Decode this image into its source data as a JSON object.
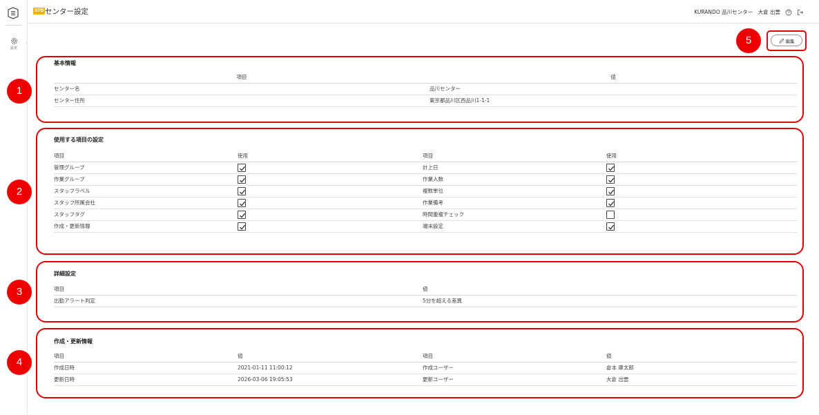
{
  "app": {
    "page_badge": "STD",
    "page_title": "センター設定",
    "user_info": "KURANDO 品川センター　大倉 出雲",
    "rail_settings_label": "設定"
  },
  "actions": {
    "edit_label": "編集"
  },
  "basic_info": {
    "title": "基本情報",
    "headers": [
      "項目",
      "値"
    ],
    "rows": [
      [
        "センター名",
        "品川センター"
      ],
      [
        "センター住所",
        "東京都品川区西品川1-1-1"
      ]
    ]
  },
  "usage_settings": {
    "title": "使用する項目の設定",
    "headers": [
      "項目",
      "使用",
      "項目",
      "使用"
    ],
    "rows": [
      {
        "left": "管理グループ",
        "left_checked": true,
        "right": "計上日",
        "right_checked": true
      },
      {
        "left": "作業グループ",
        "left_checked": true,
        "right": "作業人数",
        "right_checked": true
      },
      {
        "left": "スタッフラベル",
        "left_checked": true,
        "right": "複数単位",
        "right_checked": true
      },
      {
        "left": "スタッフ所属会社",
        "left_checked": true,
        "right": "作業備考",
        "right_checked": true
      },
      {
        "left": "スタッフタグ",
        "left_checked": true,
        "right": "時間重複チェック",
        "right_checked": false
      },
      {
        "left": "作成・更新情報",
        "left_checked": true,
        "right": "端末設定",
        "right_checked": true
      }
    ]
  },
  "detail_settings": {
    "title": "詳細設定",
    "headers": [
      "項目",
      "値"
    ],
    "rows": [
      [
        "出勤アラート判定",
        "5分を超える差異"
      ]
    ]
  },
  "audit_info": {
    "title": "作成・更新情報",
    "headers": [
      "項目",
      "値",
      "項目",
      "値"
    ],
    "rows": [
      [
        "作成日時",
        "2021-01-11 11:00:12",
        "作成ユーザー",
        "倉本 庫太郎"
      ],
      [
        "更新日時",
        "2026-03-06 19:05:53",
        "更新ユーザー",
        "大倉 出雲"
      ]
    ]
  },
  "markers": [
    "1",
    "2",
    "3",
    "4",
    "5"
  ],
  "colors": {
    "annotation_red": "#e00000",
    "badge": "#f0b400"
  },
  "icons": [
    "app-logo-icon",
    "gear-icon",
    "help-icon",
    "logout-icon",
    "pencil-icon",
    "checkmark-icon"
  ]
}
